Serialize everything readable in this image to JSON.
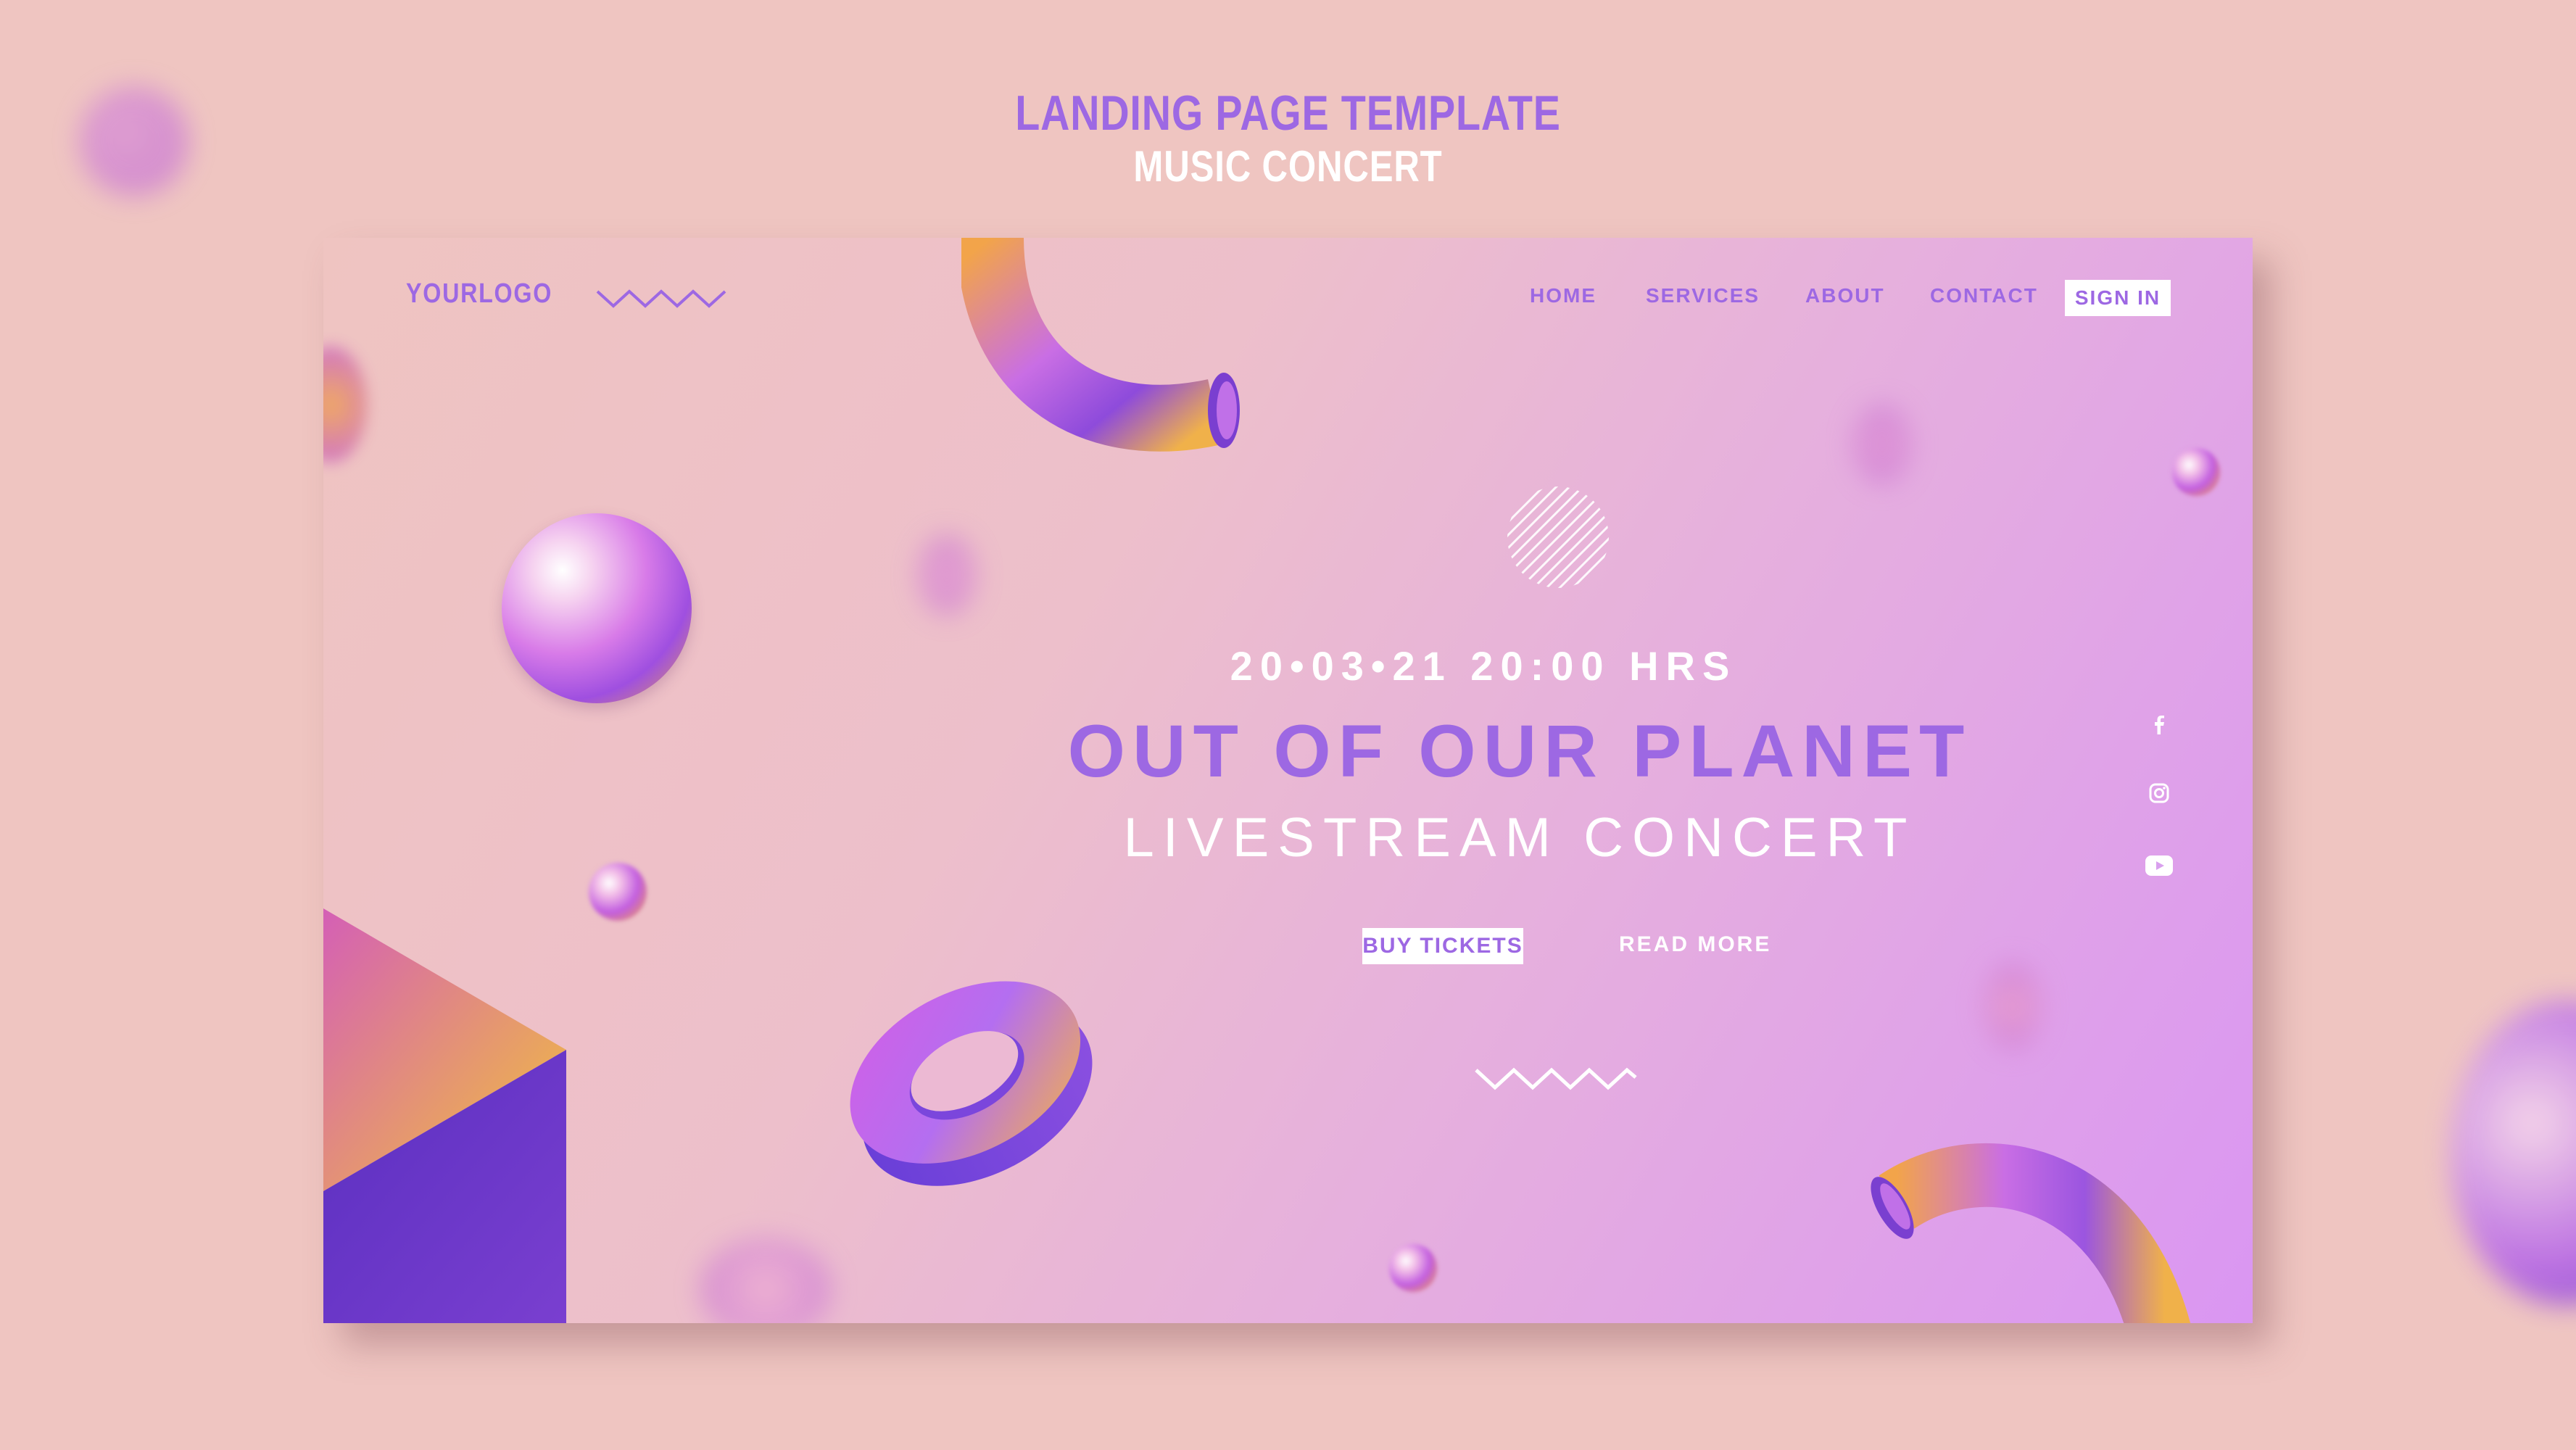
{
  "header": {
    "title": "LANDING PAGE TEMPLATE",
    "subtitle": "MUSIC CONCERT"
  },
  "site": {
    "logo": "YOURLOGO",
    "nav": {
      "home": "HOME",
      "services": "SERVICES",
      "about": "ABOUT",
      "contact": "CONTACT",
      "signin": "SIGN IN"
    },
    "hero": {
      "date": "20•03•21  20:00 HRS",
      "headline": "OUT OF OUR PLANET",
      "subheadline": "LIVESTREAM CONCERT",
      "buy_label": "BUY TICKETS",
      "read_more_label": "READ MORE"
    },
    "social": [
      "facebook-icon",
      "instagram-icon",
      "youtube-icon"
    ]
  },
  "colors": {
    "background": "#efc5c1",
    "accent": "#9d68e3",
    "text_light": "#ffffff"
  }
}
